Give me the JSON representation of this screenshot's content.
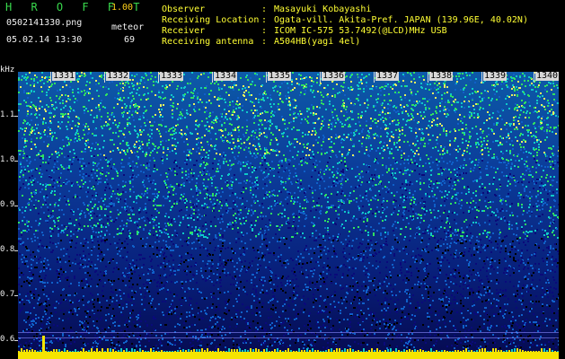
{
  "header": {
    "app_name": "H R O F F T",
    "app_version": "1.00",
    "filename": "0502141330.png",
    "datetime": "05.02.14 13:30",
    "meteor_label": "meteor",
    "meteor_count": "69",
    "meta": [
      {
        "key": "Observer",
        "value": "Masayuki Kobayashi"
      },
      {
        "key": "Receiving Location",
        "value": "Ogata-vill. Akita-Pref. JAPAN (139.96E, 40.02N)"
      },
      {
        "key": "Receiver",
        "value": "ICOM IC-575 53.7492(@LCD)MHz USB"
      },
      {
        "key": "Receiving antenna",
        "value": "A504HB(yagi 4el)"
      }
    ],
    "colon": ":"
  },
  "spectrogram": {
    "y_unit": "kHz",
    "y_ticks": [
      "1.1",
      "1.0",
      "0.9",
      "0.8",
      "0.7",
      "0.6"
    ],
    "x_ticks": [
      "1331",
      "1332",
      "1333",
      "1334",
      "1335",
      "1336",
      "1337",
      "1338",
      "1339",
      "1340"
    ],
    "colors": {
      "background": "#000000",
      "deep": "#0a0a7a",
      "mid": "#1060c8",
      "bright": "#10c8c8",
      "hot": "#30e060",
      "signal": "#f5e400",
      "line": "#8a8aff"
    }
  }
}
